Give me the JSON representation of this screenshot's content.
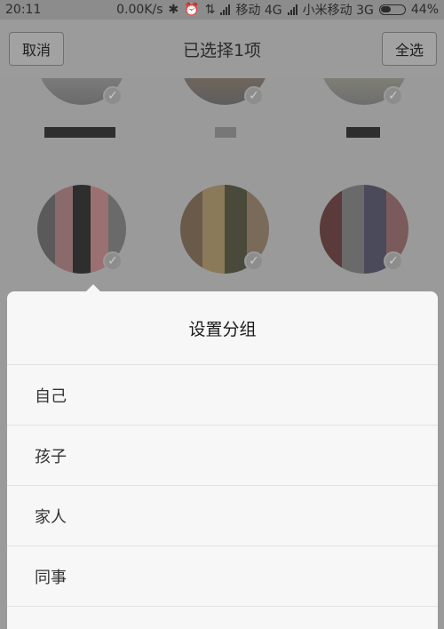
{
  "status_bar": {
    "time": "20:11",
    "speed": "0.00K/s",
    "carrier1": "移动 4G",
    "carrier2": "小米移动 3G",
    "battery": "44%"
  },
  "header": {
    "cancel_label": "取消",
    "title": "已选择1项",
    "select_all_label": "全选"
  },
  "contacts": [
    {
      "name_masked": true
    },
    {
      "name_masked": true
    },
    {
      "name_masked": true
    },
    {
      "name_masked": true
    },
    {
      "name_masked": true
    },
    {
      "name_masked": true
    }
  ],
  "sheet": {
    "title": "设置分组",
    "options": [
      {
        "label": "自己"
      },
      {
        "label": "孩子"
      },
      {
        "label": "家人"
      },
      {
        "label": "同事"
      }
    ]
  },
  "icons": {
    "bluetooth": "bluetooth-icon",
    "alarm": "alarm-icon",
    "check": "check-icon"
  },
  "colors": {
    "overlay": "#9a9a9a",
    "sheet": "#f7f7f7",
    "text": "#1a1a1a"
  }
}
